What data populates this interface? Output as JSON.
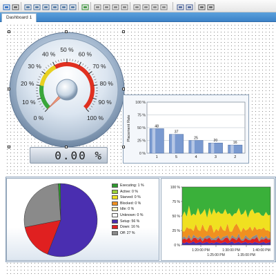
{
  "toolbar": {
    "buttons": [
      {
        "icon": "star-icon",
        "color": "#3b76c5"
      },
      {
        "icon": "chevron-down-icon",
        "color": "#6b6b6b"
      },
      {
        "icon": "align-left-icon",
        "color": "#5b7fa8"
      },
      {
        "icon": "align-center-icon",
        "color": "#5b7fa8"
      },
      {
        "icon": "align-right-icon",
        "color": "#5b7fa8"
      },
      {
        "icon": "align-top-icon",
        "color": "#5b7fa8"
      },
      {
        "icon": "align-middle-icon",
        "color": "#5b7fa8"
      },
      {
        "icon": "align-bottom-icon",
        "color": "#5b7fa8"
      },
      {
        "icon": "same-size-icon",
        "color": "#4a9a4a"
      },
      {
        "icon": "move-left-icon",
        "color": "#8a8a8a"
      },
      {
        "icon": "move-right-icon",
        "color": "#8a8a8a"
      },
      {
        "icon": "move-up-icon",
        "color": "#8a8a8a"
      },
      {
        "icon": "move-down-icon",
        "color": "#8a8a8a"
      },
      {
        "icon": "space-horizontal-icon",
        "color": "#8a8a8a"
      },
      {
        "icon": "space-vertical-icon",
        "color": "#8a8a8a"
      },
      {
        "icon": "center-horizontal-icon",
        "color": "#8a8a8a"
      },
      {
        "icon": "center-vertical-icon",
        "color": "#8a8a8a"
      },
      {
        "icon": "bring-front-icon",
        "color": "#5a6fa0"
      },
      {
        "icon": "send-back-icon",
        "color": "#5a6fa0"
      },
      {
        "icon": "group-icon",
        "color": "#6a6a6a"
      },
      {
        "icon": "ungroup-icon",
        "color": "#6a6a6a"
      }
    ]
  },
  "tabs": [
    {
      "label": "Dashboard 1",
      "active": true
    }
  ],
  "gauge": {
    "ticks": [
      "0 %",
      "10 %",
      "20 %",
      "30 %",
      "40 %",
      "50 %",
      "60 %",
      "70 %",
      "80 %",
      "90 %",
      "100 %"
    ],
    "value": 0,
    "readout": "0.00 %",
    "band_colors": {
      "green": "#3aa63a",
      "yellow": "#e8d020",
      "red": "#e03020"
    }
  },
  "bar_chart": {
    "chart_data": {
      "type": "bar",
      "categories": [
        "1",
        "5",
        "4",
        "3",
        "2"
      ],
      "values": [
        48,
        37,
        25,
        20,
        16
      ],
      "value_labels": [
        "48",
        "37",
        "25",
        "20",
        "16"
      ],
      "ylabel": "Placement Rate",
      "y_ticks": [
        "0 %",
        "25 %",
        "50 %",
        "75 %",
        "100 %"
      ],
      "ylim": [
        0,
        100
      ],
      "grid": true,
      "bar_color": "#7a9ad0"
    }
  },
  "pie_chart": {
    "chart_data": {
      "type": "pie",
      "slices": [
        {
          "label": "Executing: 1 %",
          "value": 1,
          "color": "#2e9a2e"
        },
        {
          "label": "Active: 0 %",
          "value": 0,
          "color": "#9ad03a"
        },
        {
          "label": "Starved: 0 %",
          "value": 0,
          "color": "#f0e020"
        },
        {
          "label": "Blocked: 0 %",
          "value": 0,
          "color": "#f09020"
        },
        {
          "label": "Idle: 0 %",
          "value": 0,
          "color": "#f4f0c0"
        },
        {
          "label": "Unknown: 0 %",
          "value": 0,
          "color": "#ffffff"
        },
        {
          "label": "Setup: 56 %",
          "value": 56,
          "color": "#4a2eb0"
        },
        {
          "label": "Down: 16 %",
          "value": 16,
          "color": "#e02020"
        },
        {
          "label": "Off: 27 %",
          "value": 27,
          "color": "#8a8a8a"
        }
      ]
    }
  },
  "area_chart": {
    "chart_data": {
      "type": "area",
      "y_ticks": [
        "0 %",
        "25 %",
        "50 %",
        "75 %",
        "100 %"
      ],
      "ylim": [
        0,
        100
      ],
      "x_ticks_upper": [
        "1:20:00 PM",
        "1:30:00 PM",
        "1:40:00 PM"
      ],
      "x_ticks_lower": [
        "1:25:00 PM",
        "1:35:00 PM"
      ],
      "stacked": true,
      "series": [
        {
          "color": "#4a2eb0",
          "values": [
            4,
            3,
            5,
            3,
            4,
            6,
            3,
            4,
            5,
            3,
            4,
            5,
            3,
            4,
            3,
            5,
            4,
            3,
            4,
            5,
            3,
            4,
            6,
            3,
            4,
            5,
            3,
            4,
            5,
            3,
            4,
            3,
            5,
            4,
            3,
            4,
            5,
            3,
            4,
            5
          ]
        },
        {
          "color": "#e02020",
          "values": [
            5,
            8,
            4,
            10,
            3,
            6,
            9,
            4,
            7,
            3,
            8,
            5,
            10,
            4,
            6,
            3,
            9,
            5,
            4,
            7,
            10,
            3,
            6,
            8,
            4,
            9,
            5,
            3,
            7,
            6,
            4,
            8,
            5,
            10,
            3,
            6,
            4,
            9,
            5,
            4
          ]
        },
        {
          "color": "#8a8a8a",
          "values": [
            3,
            4,
            2,
            5,
            3,
            6,
            2,
            4,
            3,
            5,
            2,
            6,
            3,
            4,
            2,
            5,
            3,
            2,
            6,
            3,
            4,
            2,
            5,
            3,
            4,
            6,
            2,
            3,
            5,
            4,
            2,
            3,
            6,
            4,
            2,
            5,
            3,
            4,
            2,
            3
          ]
        },
        {
          "color": "#f09020",
          "values": [
            12,
            8,
            20,
            10,
            18,
            6,
            22,
            14,
            9,
            25,
            12,
            7,
            18,
            22,
            10,
            15,
            8,
            24,
            12,
            9,
            20,
            14,
            6,
            18,
            25,
            10,
            12,
            20,
            8,
            14,
            22,
            10,
            16,
            8,
            20,
            12,
            18,
            9,
            14,
            10
          ]
        },
        {
          "color": "#f0e020",
          "values": [
            25,
            35,
            18,
            40,
            22,
            30,
            15,
            38,
            28,
            20,
            36,
            24,
            30,
            18,
            42,
            26,
            34,
            20,
            28,
            38,
            16,
            32,
            26,
            22,
            18,
            34,
            30,
            24,
            36,
            20,
            26,
            38,
            22,
            30,
            28,
            24,
            20,
            32,
            26,
            30
          ]
        },
        {
          "color": "#3ab03a",
          "values": [
            51,
            42,
            51,
            32,
            50,
            49,
            49,
            36,
            48,
            44,
            38,
            53,
            36,
            48,
            37,
            46,
            42,
            46,
            46,
            38,
            47,
            45,
            51,
            46,
            45,
            36,
            48,
            46,
            39,
            53,
            42,
            38,
            46,
            44,
            44,
            49,
            50,
            43,
            49,
            48
          ]
        }
      ]
    }
  }
}
